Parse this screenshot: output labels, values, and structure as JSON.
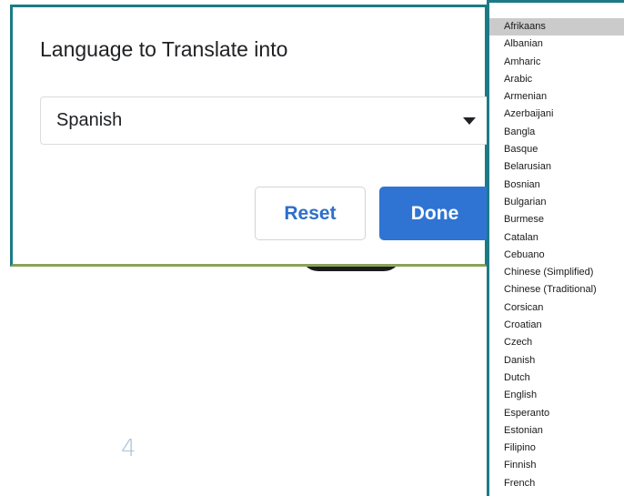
{
  "dialog": {
    "title": "Language to Translate into",
    "selected_language": "Spanish",
    "reset_label": "Reset",
    "done_label": "Done"
  },
  "background": {
    "page_number": "4"
  },
  "dropdown": {
    "highlighted": "Afrikaans",
    "options": [
      "Afrikaans",
      "Albanian",
      "Amharic",
      "Arabic",
      "Armenian",
      "Azerbaijani",
      "Bangla",
      "Basque",
      "Belarusian",
      "Bosnian",
      "Bulgarian",
      "Burmese",
      "Catalan",
      "Cebuano",
      "Chinese (Simplified)",
      "Chinese (Traditional)",
      "Corsican",
      "Croatian",
      "Czech",
      "Danish",
      "Dutch",
      "English",
      "Esperanto",
      "Estonian",
      "Filipino",
      "Finnish",
      "French"
    ]
  },
  "colors": {
    "accent": "#2f74d3",
    "focus_border": "#1c7a86",
    "highlight": "#cbcbcb"
  }
}
